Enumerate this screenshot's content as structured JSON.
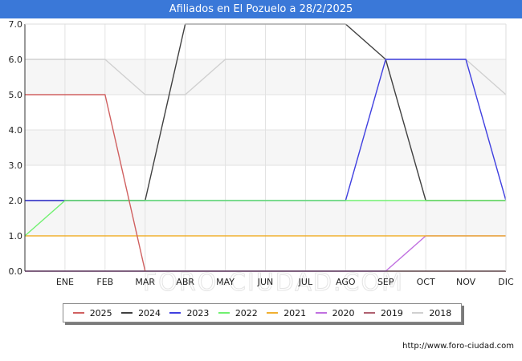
{
  "header": {
    "title": "Afiliados en El Pozuelo a 28/2/2025"
  },
  "source": "http://www.foro-ciudad.com",
  "watermark": "FORO-CIUDAD.COM",
  "chart_data": {
    "type": "line",
    "title": "Afiliados en El Pozuelo a 28/2/2025",
    "xlabel": "",
    "ylabel": "",
    "categories": [
      "",
      "ENE",
      "FEB",
      "MAR",
      "ABR",
      "MAY",
      "JUN",
      "JUL",
      "AGO",
      "SEP",
      "OCT",
      "NOV",
      "DIC"
    ],
    "y_ticks": [
      "0.0",
      "1.0",
      "2.0",
      "3.0",
      "4.0",
      "5.0",
      "6.0",
      "7.0"
    ],
    "ylim": [
      0,
      7
    ],
    "grid": true,
    "legend_position": "bottom",
    "series": [
      {
        "name": "2018",
        "color": "#d0d0d0",
        "values": [
          6,
          6,
          6,
          5,
          5,
          6,
          6,
          6,
          6,
          6,
          6,
          6,
          5
        ]
      },
      {
        "name": "2019",
        "color": "#b06070",
        "values": [
          0,
          0,
          0,
          0,
          0,
          0,
          0,
          0,
          0,
          0,
          0,
          0,
          0
        ]
      },
      {
        "name": "2020",
        "color": "#c070e0",
        "values": [
          0,
          0,
          0,
          0,
          0,
          0,
          0,
          0,
          0,
          0,
          1,
          1,
          1
        ]
      },
      {
        "name": "2021",
        "color": "#f0b030",
        "values": [
          1,
          1,
          1,
          1,
          1,
          1,
          1,
          1,
          1,
          1,
          1,
          1,
          1
        ]
      },
      {
        "name": "2022",
        "color": "#70f070",
        "values": [
          1,
          2,
          2,
          2,
          2,
          2,
          2,
          2,
          2,
          2,
          2,
          2,
          2
        ]
      },
      {
        "name": "2023",
        "color": "#4040e0",
        "values": [
          2,
          2,
          2,
          2,
          2,
          2,
          2,
          2,
          2,
          6,
          6,
          6,
          2
        ]
      },
      {
        "name": "2024",
        "color": "#404040",
        "values": [
          2,
          2,
          2,
          2,
          7,
          7,
          7,
          7,
          7,
          6,
          2,
          2,
          2
        ]
      },
      {
        "name": "2025",
        "color": "#d06060",
        "values": [
          5,
          5,
          5,
          0
        ]
      }
    ],
    "legend_order": [
      "2025",
      "2024",
      "2023",
      "2022",
      "2021",
      "2020",
      "2019",
      "2018"
    ],
    "draw_order": [
      "2018",
      "2019",
      "2020",
      "2021",
      "2024",
      "2023",
      "2022",
      "2025"
    ]
  }
}
